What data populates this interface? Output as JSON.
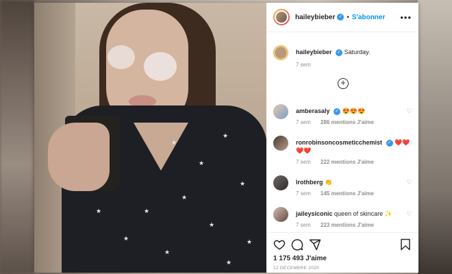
{
  "header": {
    "username": "haileybieber",
    "follow_label": "S'abonner",
    "separator": "•",
    "more_label": "•••"
  },
  "caption": {
    "username": "haileybieber",
    "text": "Saturday.",
    "time": "7 sem"
  },
  "load_more_label": "+",
  "comments": [
    {
      "username": "amberasaly",
      "text": "😍😍😍",
      "time": "7 sem",
      "likes": "286 mentions J'aime",
      "verified": true
    },
    {
      "username": "ronrobinsoncosmeticchemist",
      "text": "❤️❤️❤️❤️",
      "time": "7 sem",
      "likes": "222 mentions J'aime",
      "verified": true
    },
    {
      "username": "lrothberg",
      "text": "👏",
      "time": "7 sem",
      "likes": "145 mentions J'aime",
      "verified": false
    },
    {
      "username": "jaileysiconic",
      "text": "queen of skincare ✨",
      "time": "7 sem",
      "likes": "223 mentions J'aime",
      "verified": false
    }
  ],
  "actions": {
    "likes_total": "1 175 493 J'aime",
    "date": "12 DÉCEMBRE 2020"
  },
  "icons": [
    "heart-icon",
    "comment-icon",
    "share-icon",
    "bookmark-icon",
    "verified-icon",
    "plus-circle-icon"
  ],
  "colors": {
    "accent": "#0095f6",
    "verified": "#3897f0",
    "text": "#262626",
    "muted": "#8e8e8e"
  }
}
